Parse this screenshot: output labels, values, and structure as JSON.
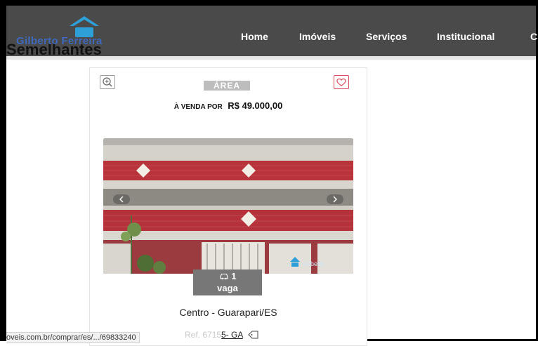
{
  "brand": {
    "name": "Gilberto Ferreira"
  },
  "section": {
    "title": "Semelhantes"
  },
  "nav": {
    "items": [
      "Home",
      "Imóveis",
      "Serviços",
      "Institucional",
      "C"
    ]
  },
  "card": {
    "area_label": "ÁREA",
    "price_prefix": "À VENDA POR",
    "price": "R$ 49.000,00",
    "vaga_count": "1",
    "vaga_label": "vaga",
    "location": "Centro - Guarapari/ES",
    "ref_prefix": "Ref. 6715",
    "ref_code": "5- GA",
    "photo_watermark": "Gilberto"
  },
  "status_bar": {
    "url": "oveis.com.br/comprar/es/.../69833240"
  },
  "icons": {
    "zoom": "zoom-in-icon",
    "favorite": "heart-icon",
    "car": "car-icon",
    "tag": "tag-icon",
    "prev": "chevron-left-icon",
    "next": "chevron-right-icon"
  },
  "colors": {
    "header": "#4a4a4a",
    "logo": "#3d6fd0",
    "favorite": "#d9475a",
    "badge": "#777777"
  }
}
